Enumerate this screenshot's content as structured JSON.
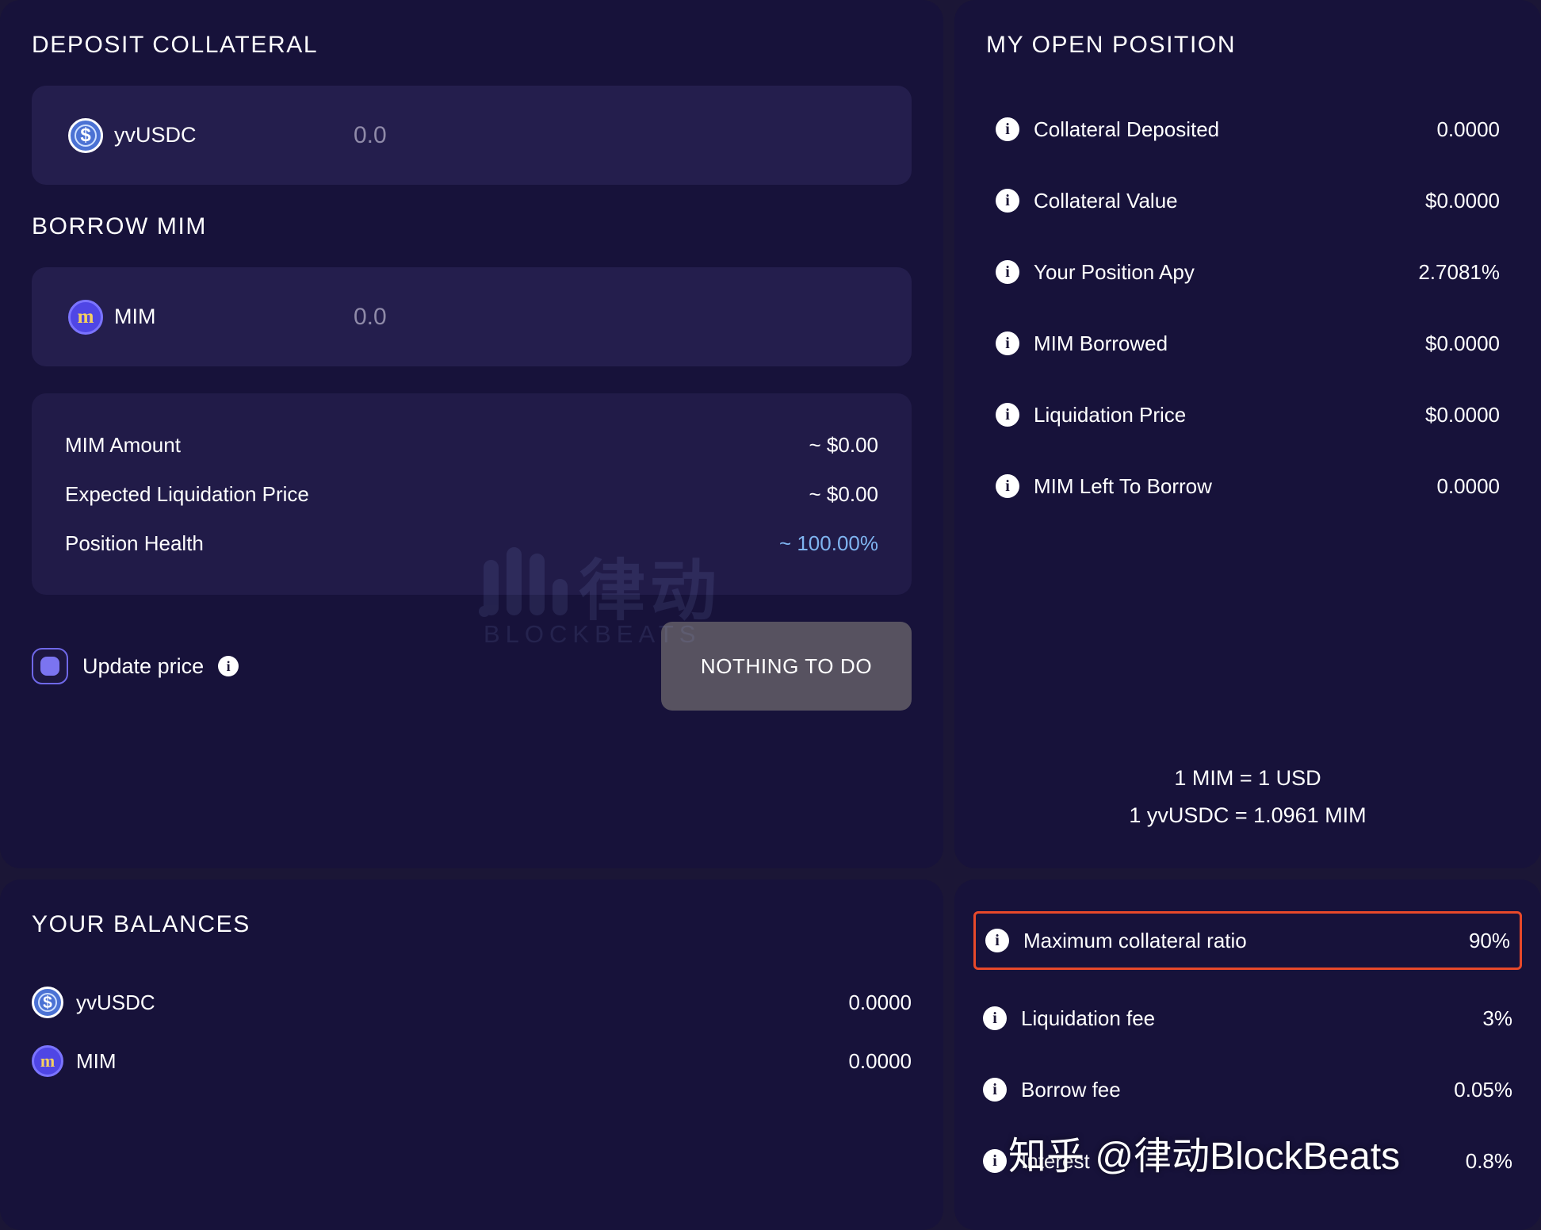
{
  "deposit": {
    "title": "DEPOSIT COLLATERAL",
    "token": {
      "name": "yvUSDC",
      "icon": "usdc-coin-icon",
      "symbol": "$"
    },
    "amount": "0.0"
  },
  "borrow": {
    "title": "BORROW MIM",
    "token": {
      "name": "MIM",
      "icon": "mim-coin-icon",
      "symbol": "m"
    },
    "amount": "0.0"
  },
  "details": {
    "rows": [
      {
        "label": "MIM Amount",
        "value": "~ $0.00",
        "accent": false
      },
      {
        "label": "Expected Liquidation Price",
        "value": "~ $0.00",
        "accent": false
      },
      {
        "label": "Position Health",
        "value": "~ 100.00%",
        "accent": true
      }
    ]
  },
  "action": {
    "update_price_label": "Update price",
    "update_price_checked": true,
    "cta_label": "NOTHING TO DO"
  },
  "balances": {
    "title": "YOUR BALANCES",
    "rows": [
      {
        "name": "yvUSDC",
        "value": "0.0000",
        "icon": "usdc-coin-icon",
        "symbol": "$"
      },
      {
        "name": "MIM",
        "value": "0.0000",
        "icon": "mim-coin-icon",
        "symbol": "m"
      }
    ]
  },
  "open_position": {
    "title": "MY OPEN POSITION",
    "rows": [
      {
        "label": "Collateral Deposited",
        "value": "0.0000"
      },
      {
        "label": "Collateral Value",
        "value": "$0.0000"
      },
      {
        "label": "Your Position Apy",
        "value": "2.7081%"
      },
      {
        "label": "MIM Borrowed",
        "value": "$0.0000"
      },
      {
        "label": "Liquidation Price",
        "value": "$0.0000"
      },
      {
        "label": "MIM Left To Borrow",
        "value": "0.0000"
      }
    ],
    "rates": [
      "1 MIM = 1 USD",
      "1 yvUSDC = 1.0961 MIM"
    ]
  },
  "parameters": {
    "rows": [
      {
        "label": "Maximum collateral ratio",
        "value": "90%",
        "highlighted": true
      },
      {
        "label": "Liquidation fee",
        "value": "3%",
        "highlighted": false
      },
      {
        "label": "Borrow fee",
        "value": "0.05%",
        "highlighted": false
      },
      {
        "label": "Interest",
        "value": "0.8%",
        "highlighted": false
      }
    ]
  },
  "watermarks": {
    "logo_word": "BLOCKBEATS",
    "logo_cn": "律动",
    "bottom": "知乎 @律动BlockBeats"
  },
  "colors": {
    "page_bg": "#1b1636",
    "panel_bg": "#17123a",
    "input_bg": "#241e4d",
    "details_bg": "#211b48",
    "accent_blue": "#7fb4f0",
    "toggle_purple": "#7b74f0",
    "highlight_red": "#e8492a",
    "cta_gray": "#575260"
  }
}
